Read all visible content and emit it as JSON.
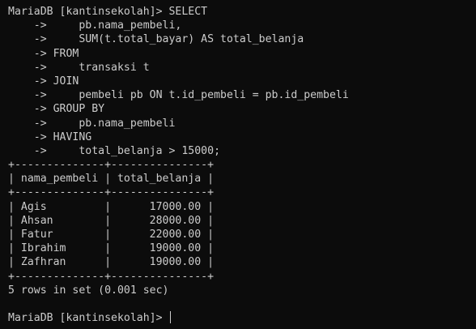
{
  "terminal": {
    "lines": [
      "MariaDB [kantinsekolah]> SELECT",
      "    ->     pb.nama_pembeli,",
      "    ->     SUM(t.total_bayar) AS total_belanja",
      "    -> FROM",
      "    ->     transaksi t",
      "    -> JOIN",
      "    ->     pembeli pb ON t.id_pembeli = pb.id_pembeli",
      "    -> GROUP BY",
      "    ->     pb.nama_pembeli",
      "    -> HAVING",
      "    ->     total_belanja > 15000;",
      "+--------------+---------------+",
      "| nama_pembeli | total_belanja |",
      "+--------------+---------------+",
      "| Agis         |      17000.00 |",
      "| Ahsan        |      28000.00 |",
      "| Fatur        |      22000.00 |",
      "| Ibrahim      |      19000.00 |",
      "| Zafhran      |      19000.00 |",
      "+--------------+---------------+",
      "5 rows in set (0.001 sec)",
      "",
      "MariaDB [kantinsekolah]> "
    ]
  }
}
